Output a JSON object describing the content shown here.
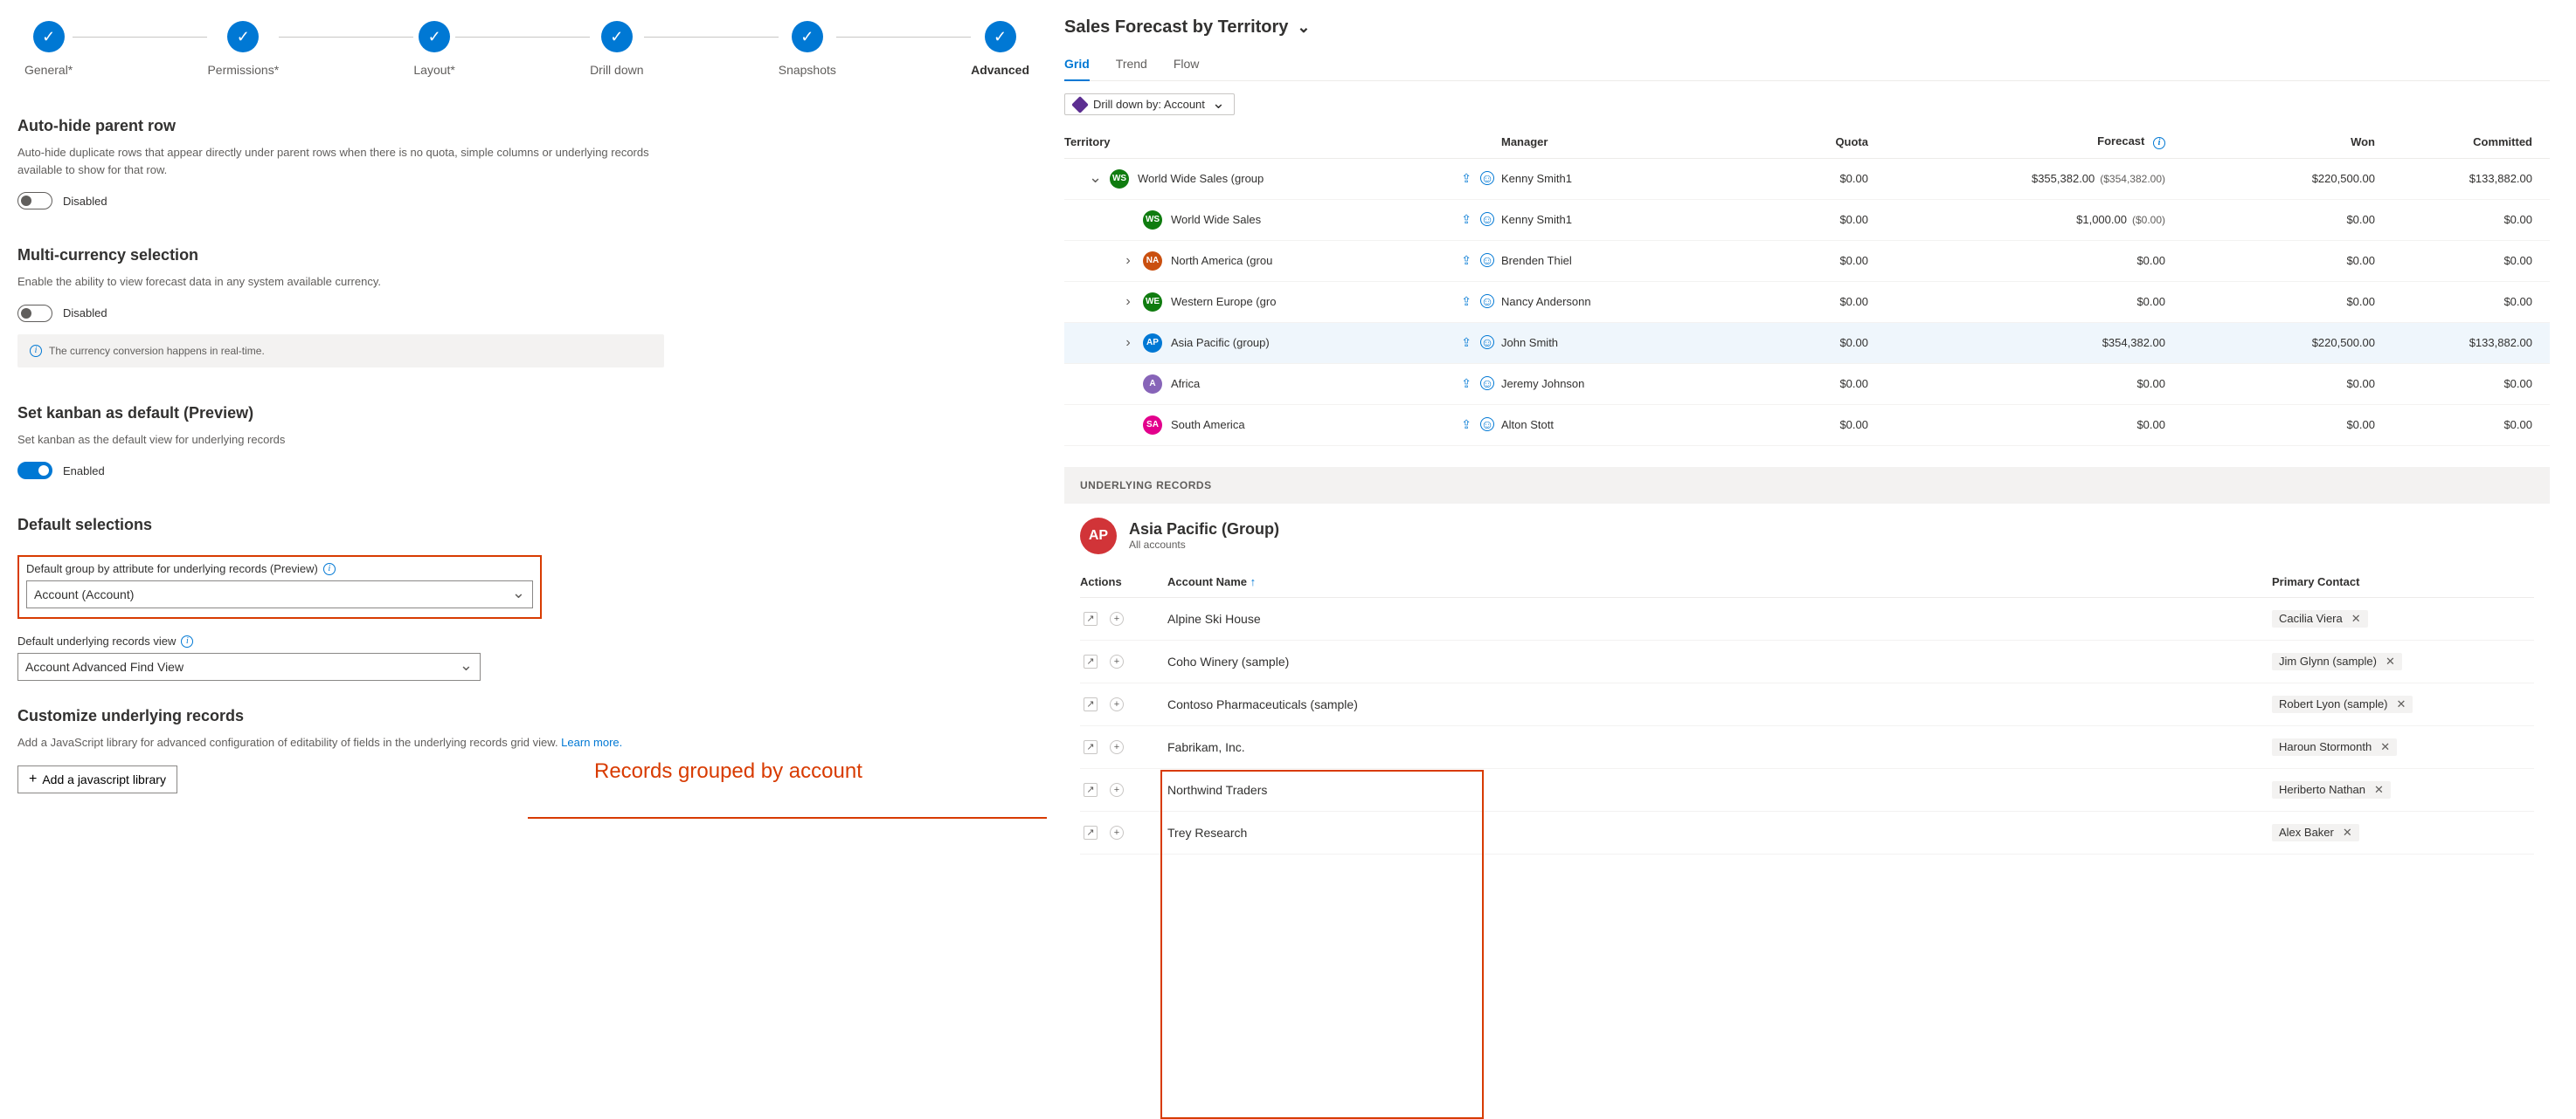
{
  "stepper": {
    "steps": [
      "General*",
      "Permissions*",
      "Layout*",
      "Drill down",
      "Snapshots",
      "Advanced"
    ],
    "active": "Advanced"
  },
  "sections": {
    "autoHide": {
      "title": "Auto-hide parent row",
      "desc": "Auto-hide duplicate rows that appear directly under parent rows when there is no quota, simple columns or underlying records available to show for that row.",
      "toggle": "Disabled"
    },
    "multiCurrency": {
      "title": "Multi-currency selection",
      "desc": "Enable the ability to view forecast data in any system available currency.",
      "toggle": "Disabled",
      "banner": "The currency conversion happens in real-time."
    },
    "kanban": {
      "title": "Set kanban as default (Preview)",
      "desc": "Set kanban as the default view for underlying records",
      "toggle": "Enabled"
    },
    "defaultSelections": {
      "title": "Default selections",
      "groupLabel": "Default group by attribute for underlying records (Preview)",
      "groupValue": "Account (Account)",
      "viewLabel": "Default underlying records view",
      "viewValue": "Account Advanced Find View"
    },
    "customize": {
      "title": "Customize underlying records",
      "desc": "Add a JavaScript library for advanced configuration of editability of fields in the underlying records grid view. ",
      "link": "Learn more.",
      "button": "Add a javascript library"
    }
  },
  "annotation": "Records grouped by account",
  "forecast": {
    "title": "Sales Forecast by Territory",
    "tabs": [
      "Grid",
      "Trend",
      "Flow"
    ],
    "activeTab": "Grid",
    "drilldown": "Drill down by: Account",
    "columns": {
      "territory": "Territory",
      "manager": "Manager",
      "quota": "Quota",
      "forecast": "Forecast",
      "won": "Won",
      "committed": "Committed"
    },
    "rows": [
      {
        "indent": 0,
        "expand": "down",
        "avatar": "WS",
        "color": "#107c10",
        "name": "World Wide Sales (group",
        "manager": "Kenny Smith1",
        "quota": "$0.00",
        "forecast": "$355,382.00",
        "hint": "($354,382.00)",
        "won": "$220,500.00",
        "committed": "$133,882.00"
      },
      {
        "indent": 1,
        "expand": "",
        "avatar": "WS",
        "color": "#107c10",
        "name": "World Wide Sales",
        "manager": "Kenny Smith1",
        "quota": "$0.00",
        "forecast": "$1,000.00",
        "hint": "($0.00)",
        "won": "$0.00",
        "committed": "$0.00"
      },
      {
        "indent": 1,
        "expand": "right",
        "avatar": "NA",
        "color": "#ca5010",
        "name": "North America (grou",
        "manager": "Brenden Thiel",
        "quota": "$0.00",
        "forecast": "$0.00",
        "hint": "",
        "won": "$0.00",
        "committed": "$0.00"
      },
      {
        "indent": 1,
        "expand": "right",
        "avatar": "WE",
        "color": "#107c10",
        "name": "Western Europe (gro",
        "manager": "Nancy Andersonn",
        "quota": "$0.00",
        "forecast": "$0.00",
        "hint": "",
        "won": "$0.00",
        "committed": "$0.00"
      },
      {
        "indent": 1,
        "expand": "right",
        "avatar": "AP",
        "color": "#0078d4",
        "name": "Asia Pacific (group)",
        "manager": "John Smith",
        "quota": "$0.00",
        "forecast": "$354,382.00",
        "hint": "",
        "won": "$220,500.00",
        "committed": "$133,882.00",
        "highlight": true
      },
      {
        "indent": 1,
        "expand": "",
        "avatar": "A",
        "color": "#8764b8",
        "name": "Africa",
        "manager": "Jeremy Johnson",
        "quota": "$0.00",
        "forecast": "$0.00",
        "hint": "",
        "won": "$0.00",
        "committed": "$0.00"
      },
      {
        "indent": 1,
        "expand": "",
        "avatar": "SA",
        "color": "#e3008c",
        "name": "South America",
        "manager": "Alton Stott",
        "quota": "$0.00",
        "forecast": "$0.00",
        "hint": "",
        "won": "$0.00",
        "committed": "$0.00"
      }
    ]
  },
  "underlying": {
    "header": "UNDERLYING RECORDS",
    "groupAvatar": "AP",
    "groupTitle": "Asia Pacific (Group)",
    "groupSub": "All accounts",
    "cols": {
      "actions": "Actions",
      "account": "Account Name",
      "contact": "Primary Contact"
    },
    "sortArrow": "↑",
    "rows": [
      {
        "name": "Alpine Ski House",
        "contact": "Cacilia Viera"
      },
      {
        "name": "Coho Winery (sample)",
        "contact": "Jim Glynn (sample)"
      },
      {
        "name": "Contoso Pharmaceuticals (sample)",
        "contact": "Robert Lyon (sample)"
      },
      {
        "name": "Fabrikam, Inc.",
        "contact": "Haroun Stormonth"
      },
      {
        "name": "Northwind Traders",
        "contact": "Heriberto Nathan"
      },
      {
        "name": "Trey Research",
        "contact": "Alex Baker"
      }
    ]
  }
}
